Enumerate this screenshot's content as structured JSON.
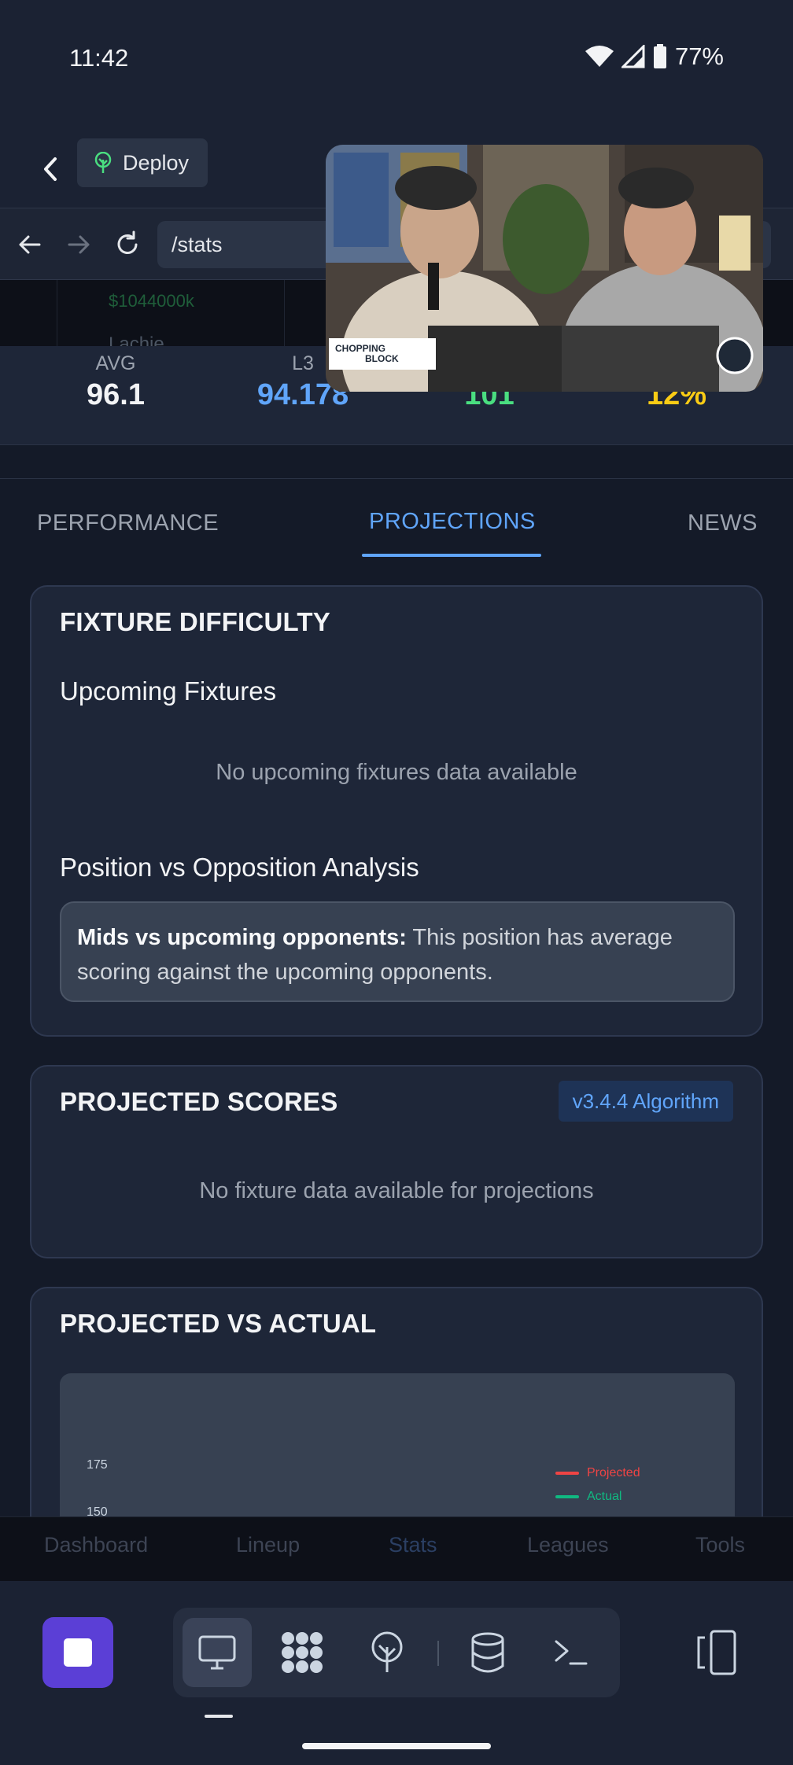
{
  "status": {
    "time": "11:42",
    "battery": "77%"
  },
  "appbar": {
    "deploy_label": "Deploy"
  },
  "browser": {
    "url": "/stats"
  },
  "background_strip": {
    "money": "$1044000k",
    "name": "Lachie"
  },
  "stats": [
    {
      "label": "AVG",
      "value": "96.1",
      "color": "#f3f4f6"
    },
    {
      "label": "L3",
      "value": "94.178",
      "color": "#60a5fa"
    },
    {
      "label": "",
      "value": "101",
      "color": "#4ade80"
    },
    {
      "label": "",
      "value": "12%",
      "color": "#facc15"
    }
  ],
  "tabs": [
    {
      "label": "PERFORMANCE",
      "active": false
    },
    {
      "label": "PROJECTIONS",
      "active": true
    },
    {
      "label": "NEWS",
      "active": false
    }
  ],
  "fixture_card": {
    "title": "FIXTURE DIFFICULTY",
    "upcoming_heading": "Upcoming Fixtures",
    "upcoming_empty": "No upcoming fixtures data available",
    "analysis_heading": "Position vs Opposition Analysis",
    "analysis_bold": "Mids vs upcoming opponents:",
    "analysis_text": " This position has average scoring against the upcoming opponents."
  },
  "projected_card": {
    "title": "PROJECTED SCORES",
    "badge": "v3.4.4 Algorithm",
    "empty": "No fixture data available for projections"
  },
  "pva_card": {
    "title": "PROJECTED VS ACTUAL"
  },
  "chart_data": {
    "type": "line",
    "title": "",
    "y_ticks": [
      "175",
      "150"
    ],
    "series": [
      {
        "name": "Projected",
        "color": "#ef4444",
        "values": []
      },
      {
        "name": "Actual",
        "color": "#10b981",
        "values": []
      }
    ],
    "legend_position": "top-right"
  },
  "webnav": [
    "Dashboard",
    "Lineup",
    "Stats",
    "Leagues",
    "Tools"
  ],
  "pip": {
    "label_line1": "CHOPPING",
    "label_line2": "BLOCK"
  },
  "icons": {
    "wifi": "wifi-icon",
    "signal": "signal-icon",
    "battery": "battery-icon",
    "back": "chevron-left-icon",
    "deploy": "deploy-tree-icon",
    "nav_back": "arrow-left-icon",
    "nav_forward": "arrow-right-icon",
    "reload": "reload-icon",
    "tools": [
      "monitor-icon",
      "grid-blob-icon",
      "deploy-tree-icon",
      "database-icon",
      "terminal-icon"
    ],
    "swap": "swap-screen-icon"
  }
}
